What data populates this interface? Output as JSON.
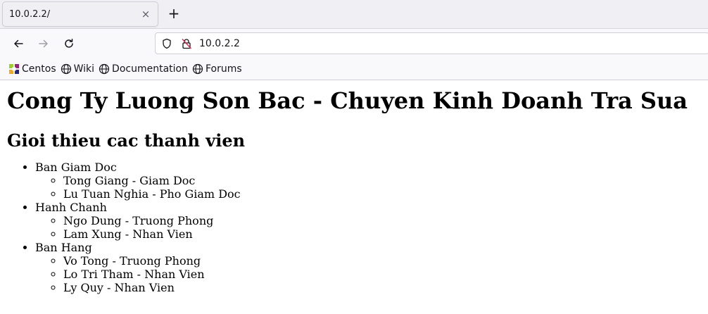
{
  "browser": {
    "tab_title": "10.0.2.2/",
    "close_glyph": "×",
    "new_tab_glyph": "+",
    "url": "10.0.2.2",
    "bookmarks": [
      {
        "label": "Centos",
        "icon": "centos-logo-icon"
      },
      {
        "label": "Wiki",
        "icon": "globe-icon"
      },
      {
        "label": "Documentation",
        "icon": "globe-icon"
      },
      {
        "label": "Forums",
        "icon": "globe-icon"
      }
    ]
  },
  "page": {
    "heading": "Cong Ty Luong Son Bac - Chuyen Kinh Doanh Tra Sua",
    "subheading": "Gioi thieu cac thanh vien",
    "departments": [
      {
        "name": "Ban Giam Doc",
        "members": [
          "Tong Giang - Giam Doc",
          "Lu Tuan Nghia - Pho Giam Doc"
        ]
      },
      {
        "name": "Hanh Chanh",
        "members": [
          "Ngo Dung - Truong Phong",
          "Lam Xung - Nhan Vien"
        ]
      },
      {
        "name": "Ban Hang",
        "members": [
          "Vo Tong - Truong Phong",
          "Lo Tri Tham - Nhan Vien",
          "Ly Quy - Nhan Vien"
        ]
      }
    ]
  }
}
